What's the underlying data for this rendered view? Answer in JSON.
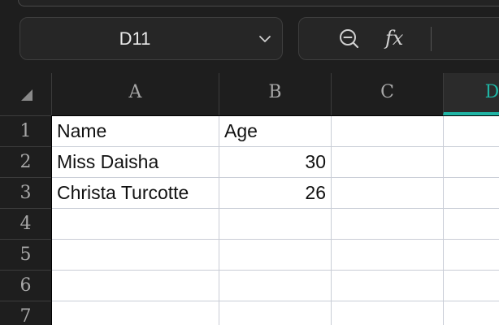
{
  "name_box": {
    "value": "D11"
  },
  "toolbar": {
    "fx_label": "fx"
  },
  "columns": [
    "A",
    "B",
    "C",
    "D"
  ],
  "active_column": "D",
  "rows": [
    "1",
    "2",
    "3",
    "4",
    "5",
    "6",
    "7"
  ],
  "cells": [
    [
      "Name",
      "Age",
      "",
      ""
    ],
    [
      "Miss Daisha",
      "30",
      "",
      ""
    ],
    [
      "Christa Turcotte",
      "26",
      "",
      ""
    ],
    [
      "",
      "",
      "",
      ""
    ],
    [
      "",
      "",
      "",
      ""
    ],
    [
      "",
      "",
      "",
      ""
    ],
    [
      "",
      "",
      "",
      ""
    ]
  ],
  "colors": {
    "accent": "#1fb5a5",
    "background": "#1e1e1e"
  }
}
